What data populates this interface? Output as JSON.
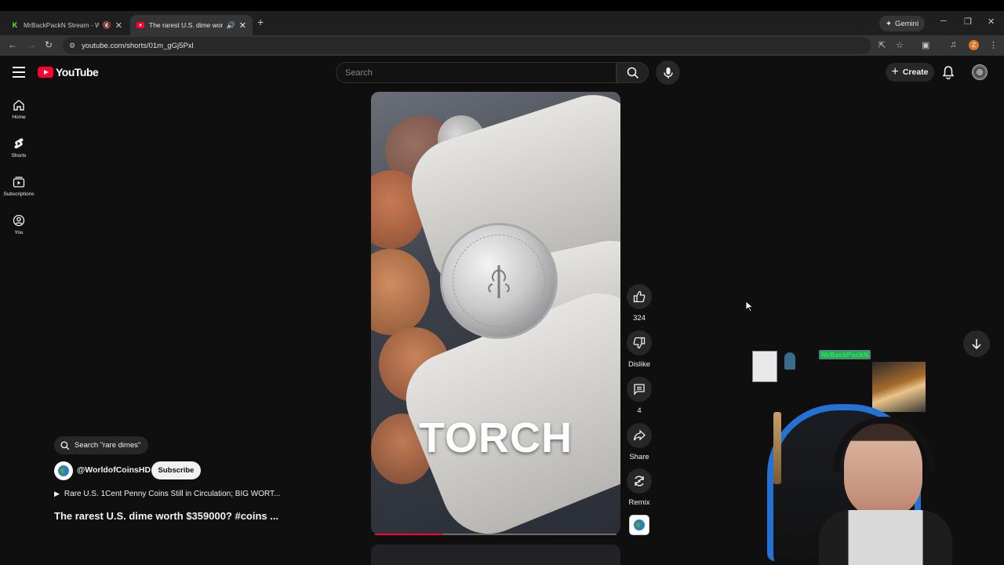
{
  "browser": {
    "tabs": [
      {
        "title": "MrBackPackN Stream - Wa",
        "active": false,
        "favicon_color": "#53fc18"
      },
      {
        "title": "The rarest U.S. dime worth",
        "active": true,
        "favicon_color": "#ff0033"
      }
    ],
    "new_tab_label": "+",
    "gemini_label": "Gemini",
    "url": "youtube.com/shorts/01m_gGj5Pxl",
    "profile_initial": "Z"
  },
  "youtube": {
    "logo_text": "YouTube",
    "search_placeholder": "Search",
    "create_label": "Create",
    "sidebar": [
      {
        "label": "Home",
        "icon": "home-icon"
      },
      {
        "label": "Shorts",
        "icon": "shorts-icon"
      },
      {
        "label": "Subscriptions",
        "icon": "subscriptions-icon"
      },
      {
        "label": "You",
        "icon": "you-icon"
      }
    ],
    "video": {
      "overlay_text": "TORCH",
      "progress": 0.28
    },
    "actions": {
      "like_count": "324",
      "dislike_label": "Dislike",
      "comment_count": "4",
      "share_label": "Share",
      "remix_label": "Remix"
    },
    "search_chip": "Search \"rare dimes\"",
    "channel_name": "@WorldofCoinsHD",
    "subscribe_label": "Subscribe",
    "related_video": "Rare U.S. 1Cent Penny Coins Still in Circulation; BIG WORT...",
    "short_title": "The rarest U.S. dime worth $359000? #coins ..."
  },
  "colors": {
    "accent": "#ff0033",
    "background": "#0f0f0f"
  },
  "stream_overlay": {
    "sign_text": "MrBackPackN"
  }
}
